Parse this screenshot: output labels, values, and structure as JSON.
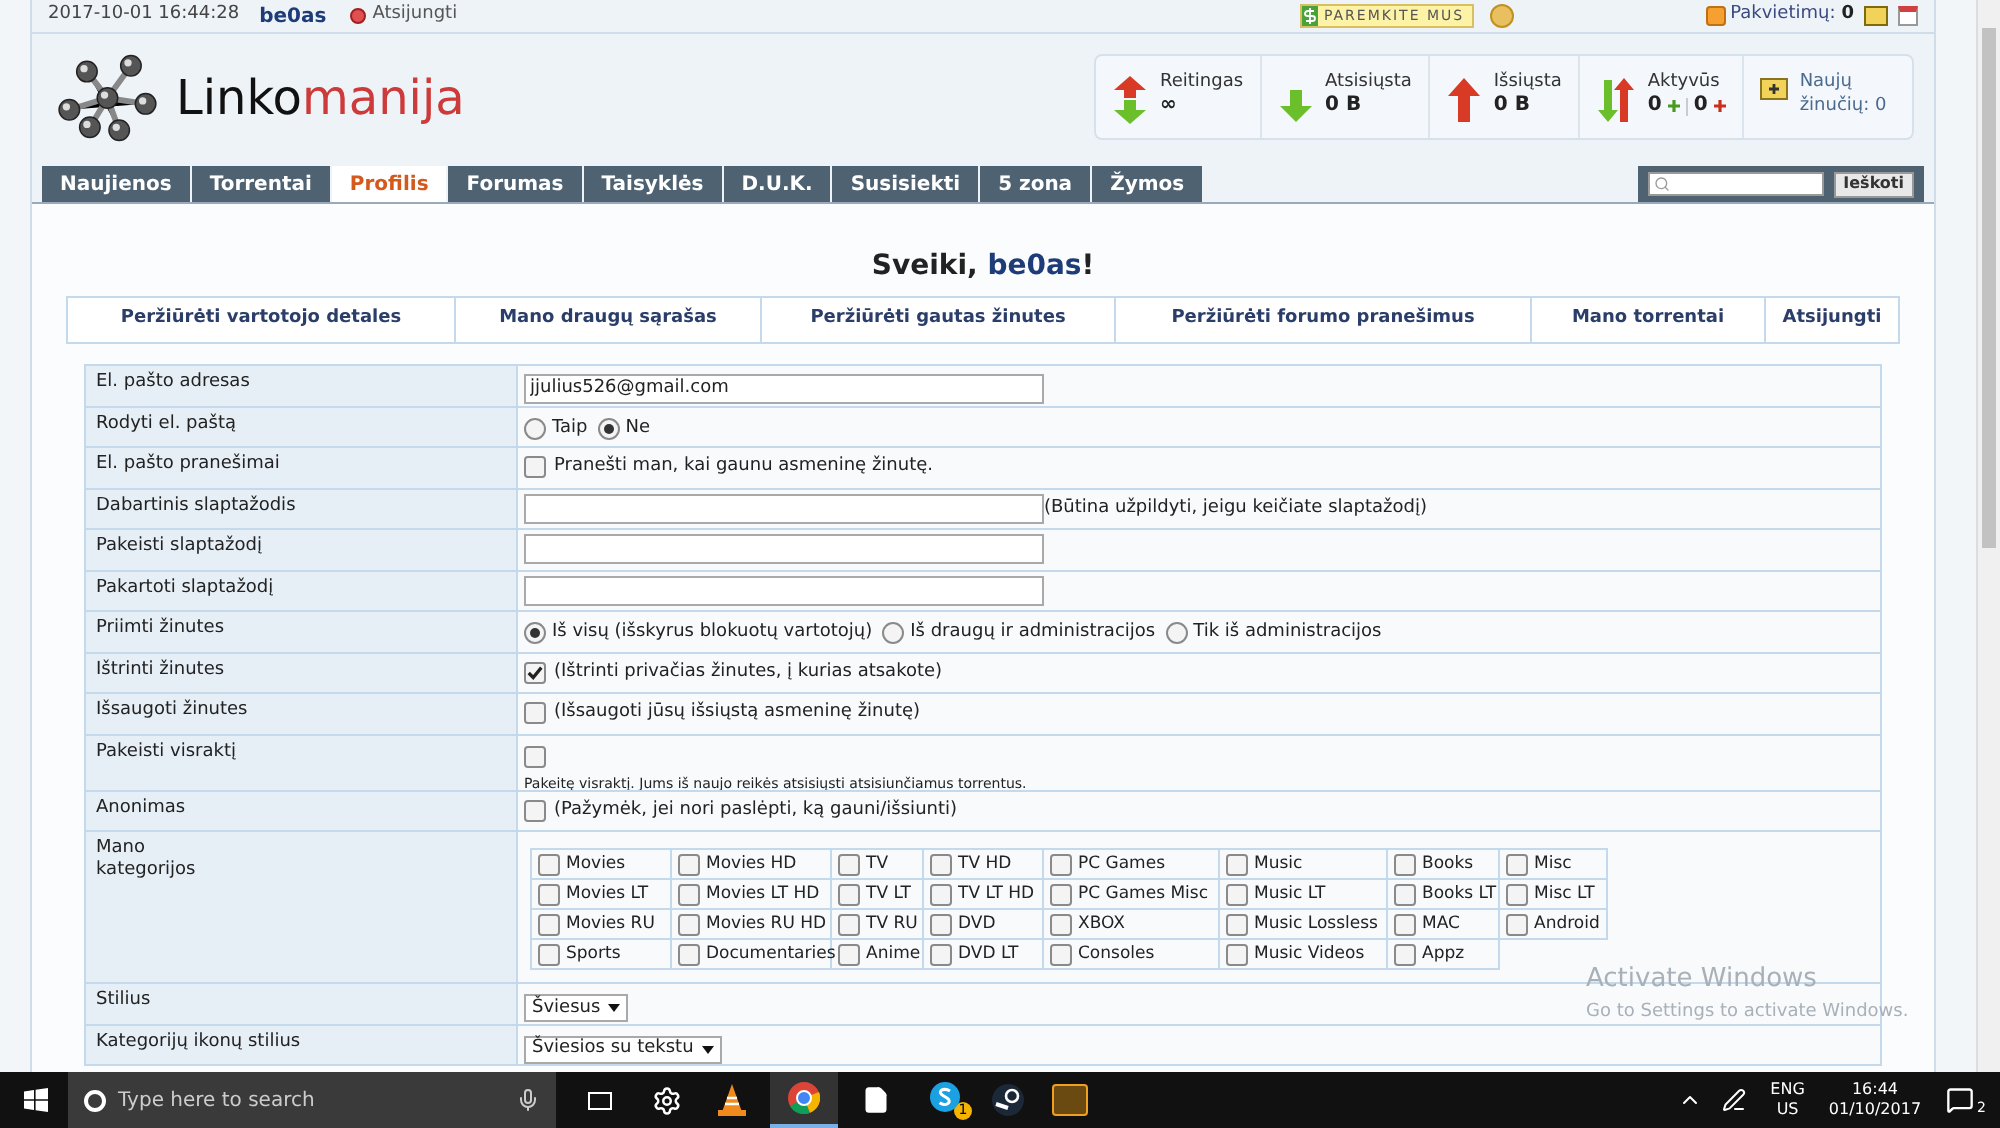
{
  "top_bar": {
    "datetime": "2017-10-01 16:44:28",
    "username": "be0as",
    "logout": "Atsijungti",
    "donate": "PAREMKITE MUS",
    "invites_label": "Pakvietimų:",
    "invites_count": "0"
  },
  "logo": {
    "dark": "Linko",
    "accent": "manija"
  },
  "stats": [
    {
      "kind": "ratio",
      "label": "Reitingas",
      "value": "∞"
    },
    {
      "kind": "down",
      "label": "Atsisiųsta",
      "value": "0 B"
    },
    {
      "kind": "up",
      "label": "Išsiųsta",
      "value": "0 B"
    },
    {
      "kind": "active",
      "label": "Aktyvūs",
      "seeding": "0",
      "leeching": "0"
    },
    {
      "kind": "messages",
      "label": "Naujų žinučių: 0"
    }
  ],
  "nav_tabs": [
    {
      "label": "Naujienos",
      "selected": false
    },
    {
      "label": "Torrentai",
      "selected": false
    },
    {
      "label": "Profilis",
      "selected": true
    },
    {
      "label": "Forumas",
      "selected": false
    },
    {
      "label": "Taisyklės",
      "selected": false
    },
    {
      "label": "D.U.K.",
      "selected": false
    },
    {
      "label": "Susisiekti",
      "selected": false
    },
    {
      "label": "5 zona",
      "selected": false
    },
    {
      "label": "Žymos",
      "selected": false
    }
  ],
  "search": {
    "button": "Ieškoti"
  },
  "greeting": {
    "prefix": "Sveiki, ",
    "name": "be0as",
    "suffix": "!"
  },
  "profile_tabs": [
    "Peržiūrėti vartotojo detales",
    "Mano draugų sąrašas",
    "Peržiūrėti gautas žinutes",
    "Peržiūrėti forumo pranešimus",
    "Mano torrentai",
    "Atsijungti"
  ],
  "form_rows": [
    {
      "kind": "text",
      "label": "El. pašto adresas",
      "value": "jjulius526@gmail.com"
    },
    {
      "kind": "radio",
      "label": "Rodyti el. paštą",
      "options": [
        {
          "label": "Taip",
          "selected": false
        },
        {
          "label": "Ne",
          "selected": true
        }
      ]
    },
    {
      "kind": "checkbox",
      "label": "El. pašto pranešimai",
      "checked": false,
      "text": "Pranešti man, kai gaunu asmeninę žinutę."
    },
    {
      "kind": "password",
      "label": "Dabartinis slaptažodis",
      "note": "(Būtina užpildyti, jeigu keičiate slaptažodį)"
    },
    {
      "kind": "password",
      "label": "Pakeisti slaptažodį"
    },
    {
      "kind": "password",
      "label": "Pakartoti slaptažodį"
    },
    {
      "kind": "radio",
      "label": "Priimti žinutes",
      "options": [
        {
          "label": "Iš visų (išskyrus blokuotų vartotojų)",
          "selected": true
        },
        {
          "label": "Iš draugų ir administracijos",
          "selected": false
        },
        {
          "label": "Tik iš administracijos",
          "selected": false
        }
      ]
    },
    {
      "kind": "checkbox",
      "label": "Ištrinti žinutes",
      "checked": true,
      "text": "(Ištrinti privačias žinutes, į kurias atsakote)"
    },
    {
      "kind": "checkbox",
      "label": "Išsaugoti žinutes",
      "checked": false,
      "text": "(Išsaugoti jūsų išsiųstą asmeninę žinutę)"
    },
    {
      "kind": "checkbox_hint",
      "label": "Pakeisti visraktį",
      "checked": false,
      "hint": "Pakeitę visraktį. Jums iš naujo reikės atsisiųsti atsisiunčiamus torrentus."
    },
    {
      "kind": "checkbox",
      "label": "Anonimas",
      "checked": false,
      "text": "(Pažymėk, jei nori paslėpti, ką gauni/išsiunti)"
    },
    {
      "kind": "categories",
      "label": "Mano\nkategorijos",
      "items": [
        {
          "label": "Movies",
          "checked": false
        },
        {
          "label": "Movies HD",
          "checked": false
        },
        {
          "label": "TV",
          "checked": false
        },
        {
          "label": "TV HD",
          "checked": false
        },
        {
          "label": "PC Games",
          "checked": false
        },
        {
          "label": "Music",
          "checked": false
        },
        {
          "label": "Books",
          "checked": false
        },
        {
          "label": "Misc",
          "checked": false
        },
        {
          "label": "Movies LT",
          "checked": false
        },
        {
          "label": "Movies LT HD",
          "checked": false
        },
        {
          "label": "TV LT",
          "checked": false
        },
        {
          "label": "TV LT HD",
          "checked": false
        },
        {
          "label": "PC Games Misc",
          "checked": false
        },
        {
          "label": "Music LT",
          "checked": false
        },
        {
          "label": "Books LT",
          "checked": false
        },
        {
          "label": "Misc LT",
          "checked": false
        },
        {
          "label": "Movies RU",
          "checked": false
        },
        {
          "label": "Movies RU HD",
          "checked": false
        },
        {
          "label": "TV RU",
          "checked": false
        },
        {
          "label": "DVD",
          "checked": false
        },
        {
          "label": "XBOX",
          "checked": false
        },
        {
          "label": "Music Lossless",
          "checked": false
        },
        {
          "label": "MAC",
          "checked": false
        },
        {
          "label": "Android",
          "checked": false
        },
        {
          "label": "Sports",
          "checked": false
        },
        {
          "label": "Documentaries",
          "checked": false
        },
        {
          "label": "Anime",
          "checked": false
        },
        {
          "label": "DVD LT",
          "checked": false
        },
        {
          "label": "Consoles",
          "checked": false
        },
        {
          "label": "Music Videos",
          "checked": false
        },
        {
          "label": "Appz",
          "checked": false
        }
      ]
    },
    {
      "kind": "select",
      "label": "Stilius",
      "value": "Šviesus"
    },
    {
      "kind": "select",
      "label": "Kategorijų ikonų stilius",
      "value": "Šviesios su tekstu"
    }
  ],
  "activation_notice": {
    "title": "Activate Windows",
    "subtitle": "Go to Settings to activate Windows."
  },
  "taskbar": {
    "search_placeholder": "Type here to search",
    "skype_badge": "1",
    "language": "ENG",
    "region": "US",
    "time": "16:44",
    "date": "01/10/2017",
    "notifications": "2"
  }
}
